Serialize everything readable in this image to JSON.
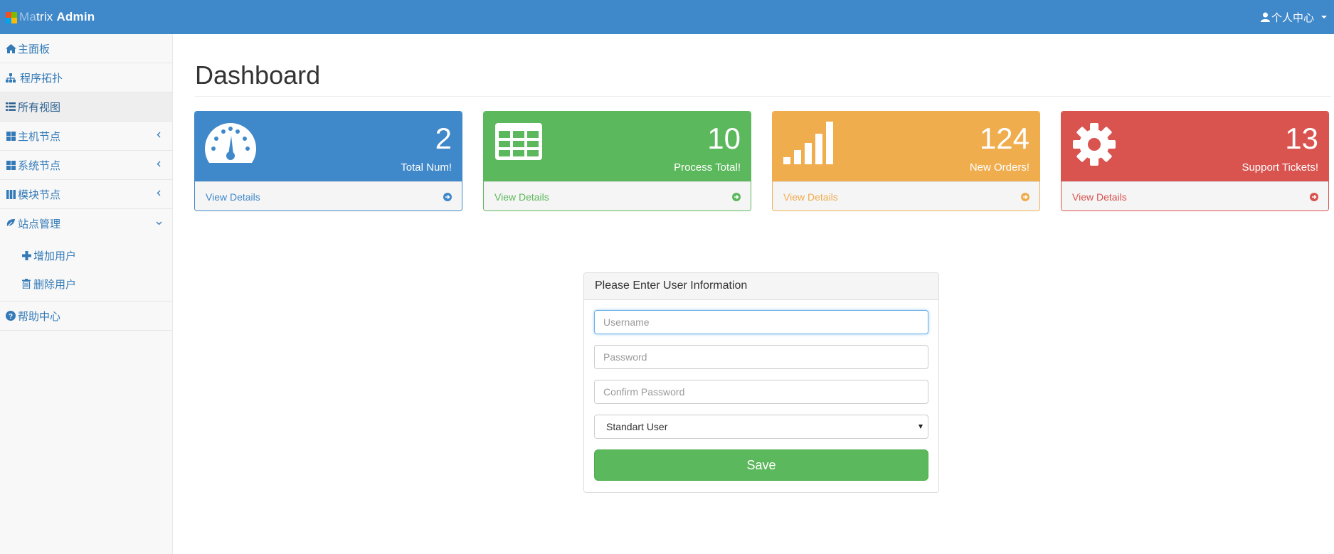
{
  "brand": {
    "prefix_light": "Ma",
    "middle": "trix",
    "suffix_bold": "Admin"
  },
  "user_menu": {
    "label": "个人中心"
  },
  "sidebar": {
    "items": [
      {
        "label": "主面板",
        "icon": "home-icon"
      },
      {
        "label": "程序拓扑",
        "icon": "sitemap-icon"
      },
      {
        "label": "所有视图",
        "icon": "list-icon",
        "active": true
      },
      {
        "label": "主机节点",
        "icon": "th-large-icon",
        "arrow": "chevron-left-icon"
      },
      {
        "label": "系统节点",
        "icon": "windows-icon",
        "arrow": "chevron-left-icon"
      },
      {
        "label": "模块节点",
        "icon": "th-icon",
        "arrow": "chevron-left-icon"
      },
      {
        "label": "站点管理",
        "icon": "leaf-icon",
        "arrow": "chevron-down-icon"
      }
    ],
    "sub_items": [
      {
        "label": "增加用户",
        "icon": "plus-icon"
      },
      {
        "label": "删除用户",
        "icon": "trash-icon"
      }
    ],
    "help": {
      "label": "帮助中心",
      "icon": "question-circle-icon"
    }
  },
  "page": {
    "title": "Dashboard"
  },
  "cards": [
    {
      "value": "2",
      "label": "Total Num!",
      "footer": "View Details",
      "color": "#3f88c9",
      "icon": "dashboard-icon"
    },
    {
      "value": "10",
      "label": "Process Total!",
      "footer": "View Details",
      "color": "#5cb85c",
      "icon": "table-icon"
    },
    {
      "value": "124",
      "label": "New Orders!",
      "footer": "View Details",
      "color": "#f0ad4e",
      "icon": "signal-icon"
    },
    {
      "value": "13",
      "label": "Support Tickets!",
      "footer": "View Details",
      "color": "#d9534f",
      "icon": "gear-icon"
    }
  ],
  "form": {
    "heading": "Please Enter User Information",
    "username_placeholder": "Username",
    "password_placeholder": "Password",
    "confirm_placeholder": "Confirm Password",
    "role_selected": "Standart User",
    "save_label": "Save"
  }
}
